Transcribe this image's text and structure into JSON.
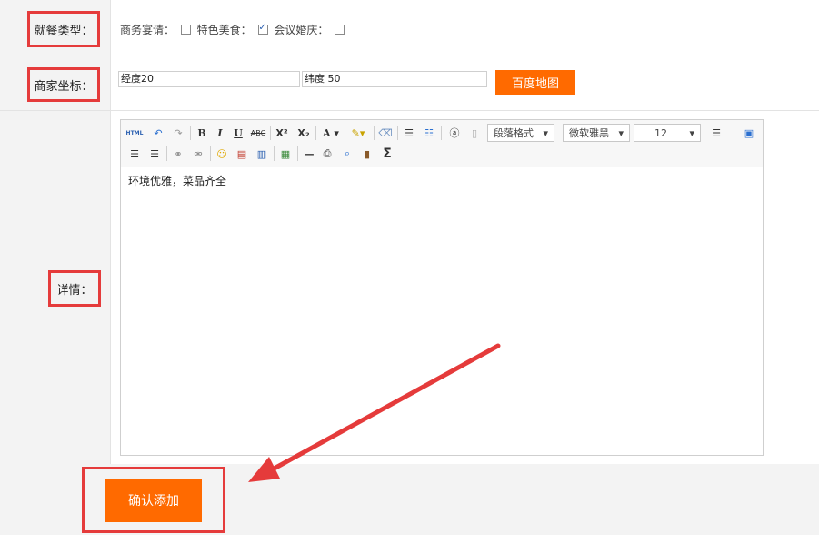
{
  "meal_type": {
    "label": "就餐类型：",
    "options": [
      {
        "label": "商务宴请：",
        "checked": false
      },
      {
        "label": "特色美食：",
        "checked": true
      },
      {
        "label": "会议婚庆：",
        "checked": false
      }
    ]
  },
  "coords": {
    "label": "商家坐标：",
    "lng_label": "经度",
    "lng_value": "20",
    "lat_label": "纬度",
    "lat_value": "50",
    "map_button": "百度地图"
  },
  "details": {
    "label": "详情：",
    "paragraph_select": "段落格式",
    "font_select": "微软雅黑",
    "size_select": "12",
    "content": "环境优雅，菜品齐全"
  },
  "submit_button": "确认添加",
  "colors": {
    "accent": "#ff6a00",
    "highlight": "#e53b3b",
    "arrow": "#e53b3b"
  }
}
